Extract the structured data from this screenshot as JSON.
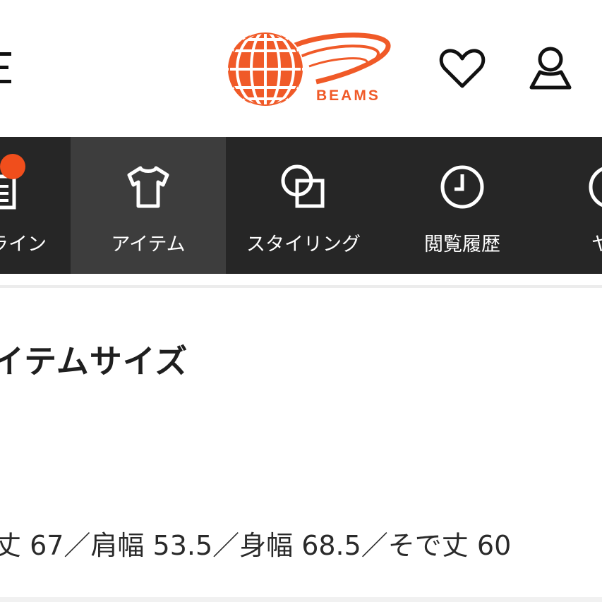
{
  "header": {
    "logo_text": "BEAMS",
    "brand_color": "#f05a28",
    "menu_icon": "menu-icon",
    "favorites_icon": "heart-icon",
    "account_icon": "user-icon"
  },
  "category_nav": {
    "items": [
      {
        "label": "ライン",
        "icon": "document-icon",
        "has_badge": true,
        "active": false
      },
      {
        "label": "アイテム",
        "icon": "tshirt-icon",
        "active": true
      },
      {
        "label": "スタイリング",
        "icon": "overlap-squares-icon",
        "active": false
      },
      {
        "label": "閲覧履歴",
        "icon": "clock-icon",
        "active": false
      },
      {
        "label": "ヤ",
        "icon": "partial-icon",
        "active": false
      }
    ],
    "badge_color": "#f04e1c"
  },
  "content": {
    "section_title": "イテムサイズ",
    "size_text": "丈 67／肩幅 53.5／身幅 68.5／そで丈 60"
  }
}
